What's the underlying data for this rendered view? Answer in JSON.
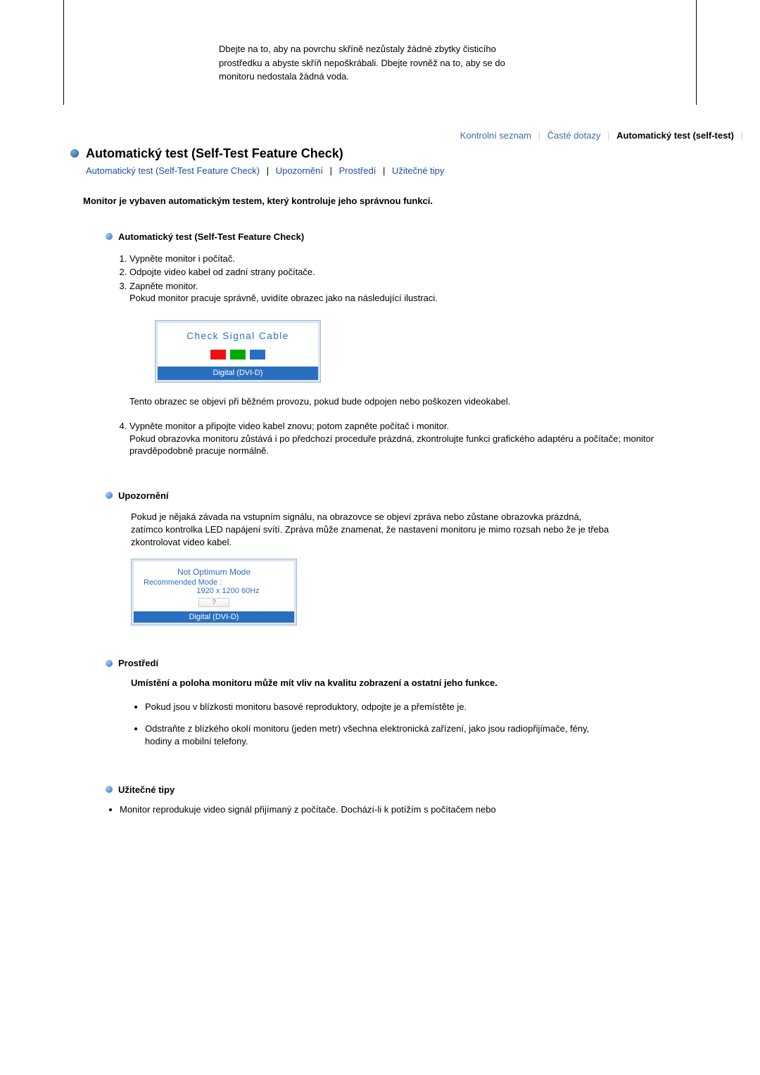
{
  "top_note": "Dbejte na to, aby na povrchu skříně nezůstaly žádné zbytky čisticího prostředku a abyste skříň nepoškrábali. Dbejte rovněž na to, aby se do monitoru nedostala žádná voda.",
  "tabs": {
    "check": "Kontrolní seznam",
    "faq": "Časté dotazy",
    "active": "Automatický test (self-test)"
  },
  "title": "Automatický test (Self-Test Feature Check)",
  "links": {
    "selftest": "Automatický test (Self-Test Feature Check)",
    "warn": "Upozornění",
    "env": "Prostředí",
    "tips": "Užitečné tipy"
  },
  "sep_pipe": "|",
  "sep_bar": "|",
  "intro": "Monitor je vybaven automatickým testem, který kontroluje jeho správnou funkci.",
  "sec1": {
    "title": "Automatický test (Self-Test Feature Check)",
    "li1": "Vypněte monitor i počítač.",
    "li2": "Odpojte video kabel od zadní strany počítače.",
    "li3a": "Zapněte monitor.",
    "li3b": "Pokud monitor pracuje správně, uvidíte obrazec jako na následující ilustraci.",
    "check_label": "Check Signal Cable",
    "check_footer": "Digital (DVI-D)",
    "para1": "Tento obrazec se objeví při běžném provozu, pokud bude odpojen nebo poškozen videokabel.",
    "li4a": "Vypněte monitor a připojte video kabel znovu; potom zapněte počítač i monitor.",
    "li4b": "Pokud obrazovka monitoru zůstává i po předchozí proceduře prázdná, zkontrolujte funkci grafického adaptéru a počítače; monitor pravděpodobně pracuje normálně."
  },
  "sec2": {
    "title": "Upozornění",
    "para": "Pokud je nějaká závada na vstupním signálu, na obrazovce se objeví zpráva nebo zůstane obrazovka prázdná, zatímco kontrolka LED napájení svítí. Zpráva může znamenat, že nastavení monitoru je mimo rozsah nebo že je třeba zkontrolovat video kabel.",
    "warn1": "Not Optimum Mode",
    "warn2": "Recommended Mode :",
    "warn3": "1920 x 1200 60Hz",
    "warn_btn": "?",
    "warn_footer": "Digital (DVI-D)"
  },
  "sec3": {
    "title": "Prostředí",
    "strong": "Umístění a poloha monitoru může mít vliv na kvalitu zobrazení a ostatní jeho funkce.",
    "li1": "Pokud jsou v blízkosti monitoru basové reproduktory, odpojte je a přemístěte je.",
    "li2": "Odstraňte z blízkého okolí monitoru (jeden metr) všechna elektronická zařízení, jako jsou radiopřijímače, fény, hodiny a mobilní telefony."
  },
  "sec4": {
    "title": "Užitečné tipy",
    "li1": "Monitor reprodukuje video signál přijímaný z počítače. Dochází-li k potížím s počítačem nebo"
  }
}
